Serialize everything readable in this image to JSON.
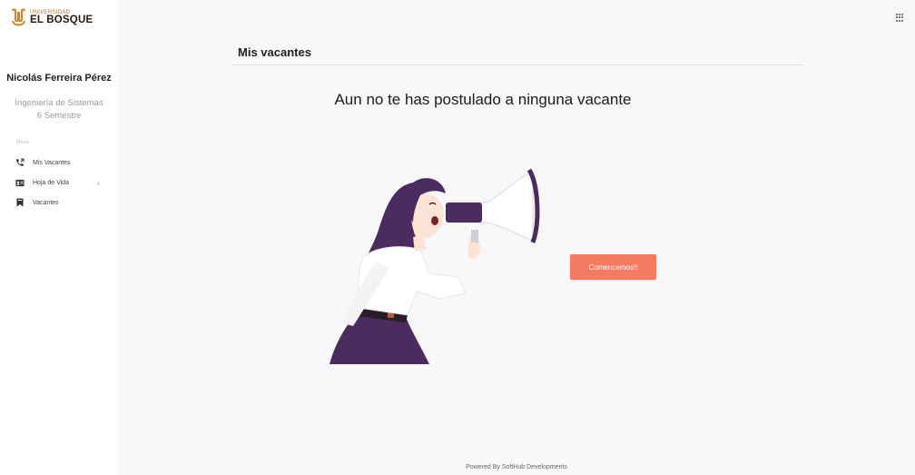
{
  "sidebar": {
    "logo": {
      "small_text": "UNIVERSIDAD",
      "big_text": "EL BOSQUE"
    },
    "user": {
      "name": "Nicolás Ferreira Pérez",
      "career": "Ingeniería de Sistemas",
      "semester": "6 Semestre"
    },
    "menu_label": "Menu",
    "items": [
      {
        "label": "Mis Vacantes",
        "icon": "phone-icon"
      },
      {
        "label": "Hoja de Vida",
        "icon": "id-card-icon",
        "has_submenu": true,
        "chevron": "›"
      },
      {
        "label": "Vacantes",
        "icon": "bookmark-icon"
      }
    ]
  },
  "header": {
    "apps_icon": "grid-icon"
  },
  "main": {
    "title": "Mis vacantes",
    "empty_message": "Aun no te has postulado a ninguna vacante",
    "cta_label": "Comencemos!!"
  },
  "footer": {
    "text": "Powered By SoftHub Developments"
  },
  "colors": {
    "accent": "#f47a62",
    "brand_gold": "#c8892f",
    "purple": "#4a2c5e"
  }
}
